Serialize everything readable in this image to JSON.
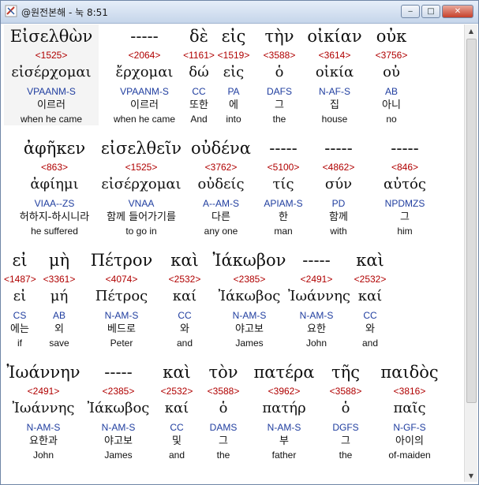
{
  "window": {
    "title": "@원전본해 - 눅 8:51",
    "minimize_glyph": "‒",
    "maximize_glyph": "□",
    "close_glyph": "✕",
    "icon": "app-icon"
  },
  "rows": [
    [
      {
        "greek": "Εἰσελθὼν",
        "num": "<1525>",
        "lemma": "εἰσέρχομαι",
        "parse": "VPAANM-S",
        "korean": "이르러",
        "english": "when he came"
      },
      {
        "greek": "-----",
        "num": "<2064>",
        "lemma": "ἔρχομαι",
        "parse": "VPAANM-S",
        "korean": "이르러",
        "english": "when he came"
      },
      {
        "greek": "δὲ",
        "num": "<1161>",
        "lemma": "δώ",
        "parse": "CC",
        "korean": "또한",
        "english": "And"
      },
      {
        "greek": "εἰς",
        "num": "<1519>",
        "lemma": "εἰς",
        "parse": "PA",
        "korean": "에",
        "english": "into"
      },
      {
        "greek": "τὴν",
        "num": "<3588>",
        "lemma": "ὁ",
        "parse": "DAFS",
        "korean": "그",
        "english": "the"
      },
      {
        "greek": "οἰκίαν",
        "num": "<3614>",
        "lemma": "οἰκία",
        "parse": "N-AF-S",
        "korean": "집",
        "english": "house"
      },
      {
        "greek": "οὐκ",
        "num": "<3756>",
        "lemma": "οὐ",
        "parse": "AB",
        "korean": "아니",
        "english": "no"
      }
    ],
    [
      {
        "greek": "ἀφῆκεν",
        "num": "<863>",
        "lemma": "ἀφίημι",
        "parse": "VIAA--ZS",
        "korean": "허하지-하시니라",
        "english": "he suffered"
      },
      {
        "greek": "εἰσελθεῖν",
        "num": "<1525>",
        "lemma": "εἰσέρχομαι",
        "parse": "VNAA",
        "korean": "함께 들어가기를",
        "english": "to go in"
      },
      {
        "greek": "οὐδένα",
        "num": "<3762>",
        "lemma": "οὐδείς",
        "parse": "A--AM-S",
        "korean": "다른",
        "english": "any one"
      },
      {
        "greek": "-----",
        "num": "<5100>",
        "lemma": "τίς",
        "parse": "APIAM-S",
        "korean": "한",
        "english": "man"
      },
      {
        "greek": "-----",
        "num": "<4862>",
        "lemma": "σύν",
        "parse": "PD",
        "korean": "함께",
        "english": "with"
      },
      {
        "greek": "-----",
        "num": "<846>",
        "lemma": "αὐτός",
        "parse": "NPDMZS",
        "korean": "그",
        "english": "him"
      }
    ],
    [
      {
        "greek": "εἰ",
        "num": "<1487>",
        "lemma": "εἰ",
        "parse": "CS",
        "korean": "에는",
        "english": "if"
      },
      {
        "greek": "μὴ",
        "num": "<3361>",
        "lemma": "μή",
        "parse": "AB",
        "korean": "외",
        "english": "save"
      },
      {
        "greek": "Πέτρον",
        "num": "<4074>",
        "lemma": "Πέτρος",
        "parse": "N-AM-S",
        "korean": "베드로",
        "english": "Peter"
      },
      {
        "greek": "καὶ",
        "num": "<2532>",
        "lemma": "καί",
        "parse": "CC",
        "korean": "와",
        "english": "and"
      },
      {
        "greek": "Ἰάκωβον",
        "num": "<2385>",
        "lemma": "Ἰάκωβος",
        "parse": "N-AM-S",
        "korean": "야고보",
        "english": "James"
      },
      {
        "greek": "-----",
        "num": "<2491>",
        "lemma": "Ἰωάννης",
        "parse": "N-AM-S",
        "korean": "요한",
        "english": "John"
      },
      {
        "greek": "καὶ",
        "num": "<2532>",
        "lemma": "καί",
        "parse": "CC",
        "korean": "와",
        "english": "and"
      }
    ],
    [
      {
        "greek": "Ἰωάννην",
        "num": "<2491>",
        "lemma": "Ἰωάννης",
        "parse": "N-AM-S",
        "korean": "요한과",
        "english": "John"
      },
      {
        "greek": "-----",
        "num": "<2385>",
        "lemma": "Ἰάκωβος",
        "parse": "N-AM-S",
        "korean": "야고보",
        "english": "James"
      },
      {
        "greek": "καὶ",
        "num": "<2532>",
        "lemma": "καί",
        "parse": "CC",
        "korean": "및",
        "english": "and"
      },
      {
        "greek": "τὸν",
        "num": "<3588>",
        "lemma": "ὁ",
        "parse": "DAMS",
        "korean": "그",
        "english": "the"
      },
      {
        "greek": "πατέρα",
        "num": "<3962>",
        "lemma": "πατήρ",
        "parse": "N-AM-S",
        "korean": "부",
        "english": "father"
      },
      {
        "greek": "τῆς",
        "num": "<3588>",
        "lemma": "ὁ",
        "parse": "DGFS",
        "korean": "그",
        "english": "the"
      },
      {
        "greek": "παιδὸς",
        "num": "<3816>",
        "lemma": "παῖς",
        "parse": "N-GF-S",
        "korean": "아이의",
        "english": "of-maiden"
      }
    ]
  ]
}
